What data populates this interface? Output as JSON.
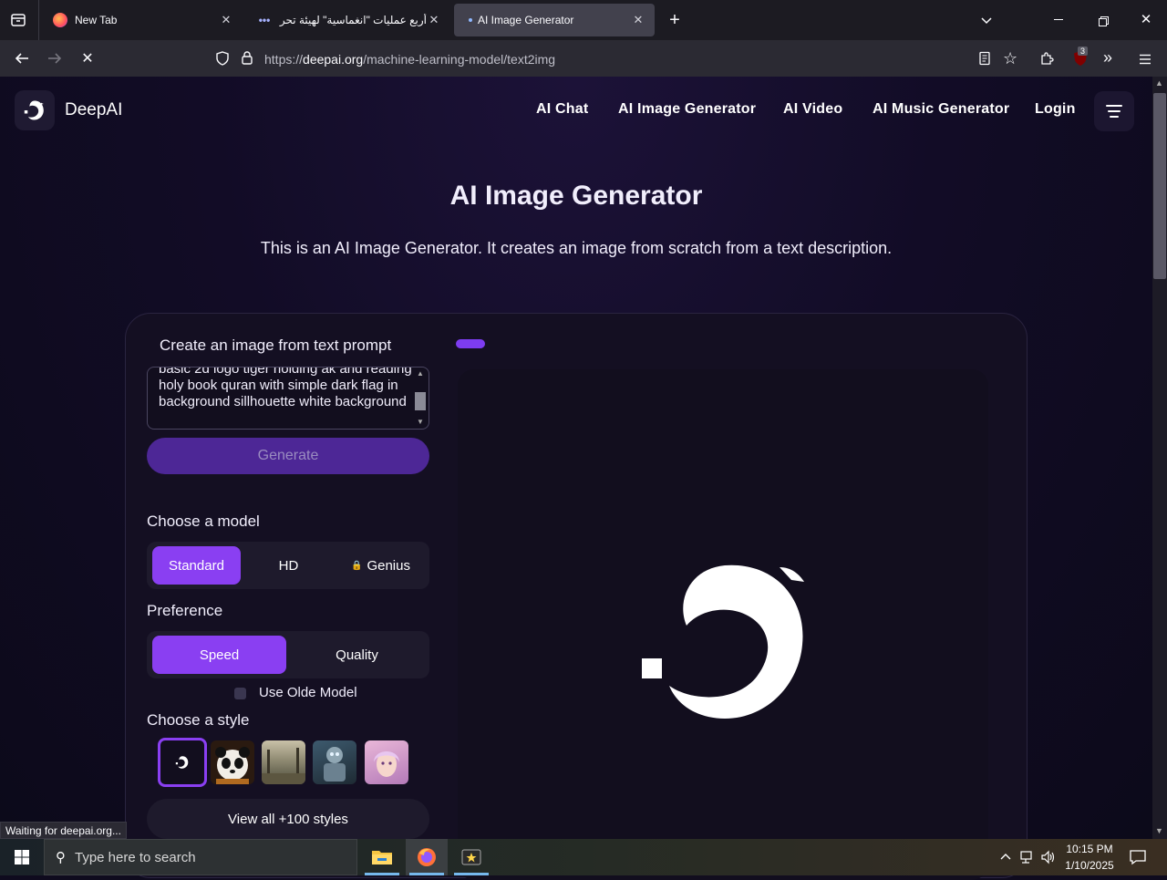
{
  "browser": {
    "tabs": [
      {
        "title": "New Tab"
      },
      {
        "title": "أربع عمليات \"انغماسية\" لهيئة تحر"
      },
      {
        "title": "AI Image Generator"
      }
    ],
    "url_prefix": "https://",
    "url_domain": "deepai.org",
    "url_path": "/machine-learning-model/text2img",
    "extension_badge": "3",
    "status": "Waiting for deepai.org..."
  },
  "site": {
    "brand": "DeepAI",
    "nav": [
      "AI Chat",
      "AI Image Generator",
      "AI Video",
      "AI Music Generator",
      "Login"
    ]
  },
  "main": {
    "title": "AI Image Generator",
    "subtitle": "This is an AI Image Generator. It creates an image from scratch from a text description.",
    "prompt_heading": "Create an image from text prompt",
    "prompt_value": "basic 2d logo tiger holding ak and reading holy book quran with simple dark flag in background sillhouette white background",
    "generate_label": "Generate",
    "model_heading": "Choose a model",
    "models": [
      "Standard",
      "HD",
      "Genius"
    ],
    "selected_model": "Standard",
    "preference_heading": "Preference",
    "preferences": [
      "Speed",
      "Quality"
    ],
    "selected_preference": "Speed",
    "old_model_label": "Use Olde Model",
    "style_heading": "Choose a style",
    "view_all_label": "View all +100 styles"
  },
  "taskbar": {
    "search_placeholder": "Type here to search",
    "time": "10:15 PM",
    "date": "1/10/2025"
  },
  "colors": {
    "accent": "#8a3ff2",
    "generate_bg": "#4d2796",
    "page_bg": "#120c26"
  }
}
